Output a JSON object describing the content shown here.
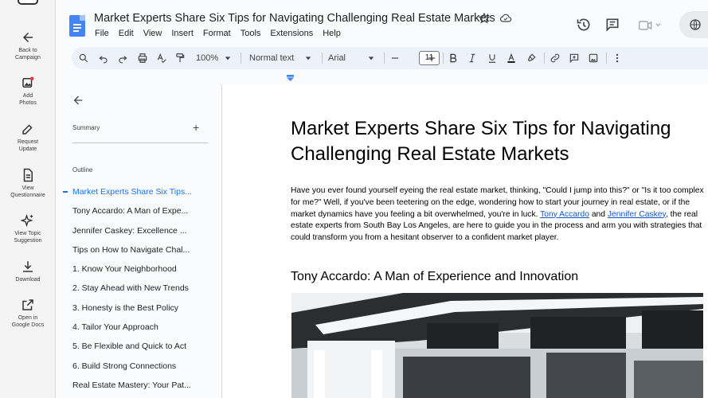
{
  "rail": {
    "items": [
      {
        "label_1": "Back to",
        "label_2": "Campaign",
        "icon": "arrow-left-icon"
      },
      {
        "label_1": "Add",
        "label_2": "Photos",
        "icon": "add-photo-icon"
      },
      {
        "label_1": "Request",
        "label_2": "Update",
        "icon": "edit-icon"
      },
      {
        "label_1": "View",
        "label_2": "Questionnaire",
        "icon": "document-icon"
      },
      {
        "label_1": "View Topic",
        "label_2": "Suggestion",
        "icon": "sparkle-icon"
      },
      {
        "label_1": "Download",
        "label_2": "",
        "icon": "download-icon"
      },
      {
        "label_1": "Open in",
        "label_2": "Google Docs",
        "icon": "external-link-icon"
      }
    ]
  },
  "header": {
    "title": "Market Experts Share Six Tips for Navigating Challenging Real Estate Markets",
    "menu": [
      "File",
      "Edit",
      "View",
      "Insert",
      "Format",
      "Tools",
      "Extensions",
      "Help"
    ]
  },
  "toolbar": {
    "zoom": "100%",
    "style": "Normal text",
    "font": "Arial",
    "font_size": "11"
  },
  "outline": {
    "summary_label": "Summary",
    "summary_add": "+",
    "outline_label": "Outline",
    "items": [
      "Market Experts Share Six Tips...",
      "Tony Accardo: A Man of Expe...",
      "Jennifer Caskey: Excellence ...",
      "Tips on How to Navigate Chal...",
      "1. Know Your Neighborhood",
      "2. Stay Ahead with New Trends",
      "3. Honesty is the Best Policy",
      "4. Tailor Your Approach",
      "5. Be Flexible and Quick to Act",
      "6. Build Strong Connections",
      "Real Estate Mastery: Your Pat..."
    ],
    "active_index": 0
  },
  "document": {
    "heading": "Market Experts Share Six Tips for Navigating Challenging Real Estate Markets",
    "para_1": "Have you ever found yourself eyeing the real estate market, thinking, \"Could I jump into this?\" or \"Is it too complex for me?\" Well, if you've been teetering on the edge, wondering how to start your journey in real estate, or if the market dynamics have you feeling a bit overwhelmed, you're in luck. ",
    "link_1": "Tony Accardo",
    "para_2": " and ",
    "link_2": "Jennifer Caskey",
    "para_3": ", the real estate experts from South Bay Los Angeles, are here to guide you in the process and arm you with strategies that could transform you from a hesitant observer to a confident market player.",
    "subheading": "Tony Accardo: A Man of Experience and Innovation"
  }
}
